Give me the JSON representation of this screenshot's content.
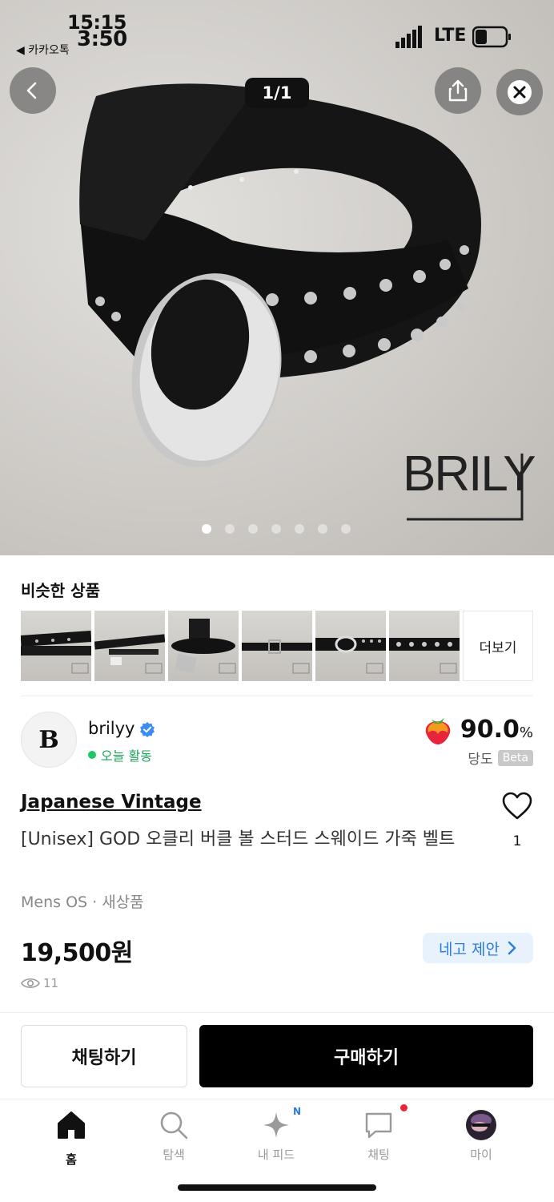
{
  "status_bar": {
    "time_primary": "15:15",
    "time_secondary": "3:50",
    "back_app": "◀ 카카오톡",
    "network": "LTE",
    "battery": "23"
  },
  "gallery": {
    "counter": "1/1",
    "watermark": "BRILY",
    "dot_count": 7,
    "active_dot": 0
  },
  "similar": {
    "title": "비슷한 상품",
    "more_label": "더보기"
  },
  "seller": {
    "logo_letter": "B",
    "name": "brilyy",
    "activity": "오늘 활동",
    "score": "90.0",
    "score_unit": "%",
    "score_label": "당도",
    "beta_label": "Beta"
  },
  "product": {
    "brand": "Japanese Vintage",
    "title": "[Unisex] GOD 오클리 버클 볼 스터드 스웨이드 가죽 벨트",
    "meta": "Mens OS · 새상품",
    "price": "19,500원",
    "like_count": "1",
    "offer_label": "네고 제안",
    "views": "11"
  },
  "actions": {
    "chat_label": "채팅하기",
    "buy_label": "구매하기"
  },
  "tabs": [
    {
      "label": "홈",
      "icon": "home-icon"
    },
    {
      "label": "탐색",
      "icon": "search-icon"
    },
    {
      "label": "내 피드",
      "icon": "sparkle-icon",
      "badge": "N"
    },
    {
      "label": "채팅",
      "icon": "chat-bubble-icon"
    },
    {
      "label": "마이",
      "icon": "profile-avatar"
    }
  ],
  "colors": {
    "accent_blue": "#2a7be0",
    "active_green": "#1ca65a",
    "notification_red": "#e8243c"
  }
}
